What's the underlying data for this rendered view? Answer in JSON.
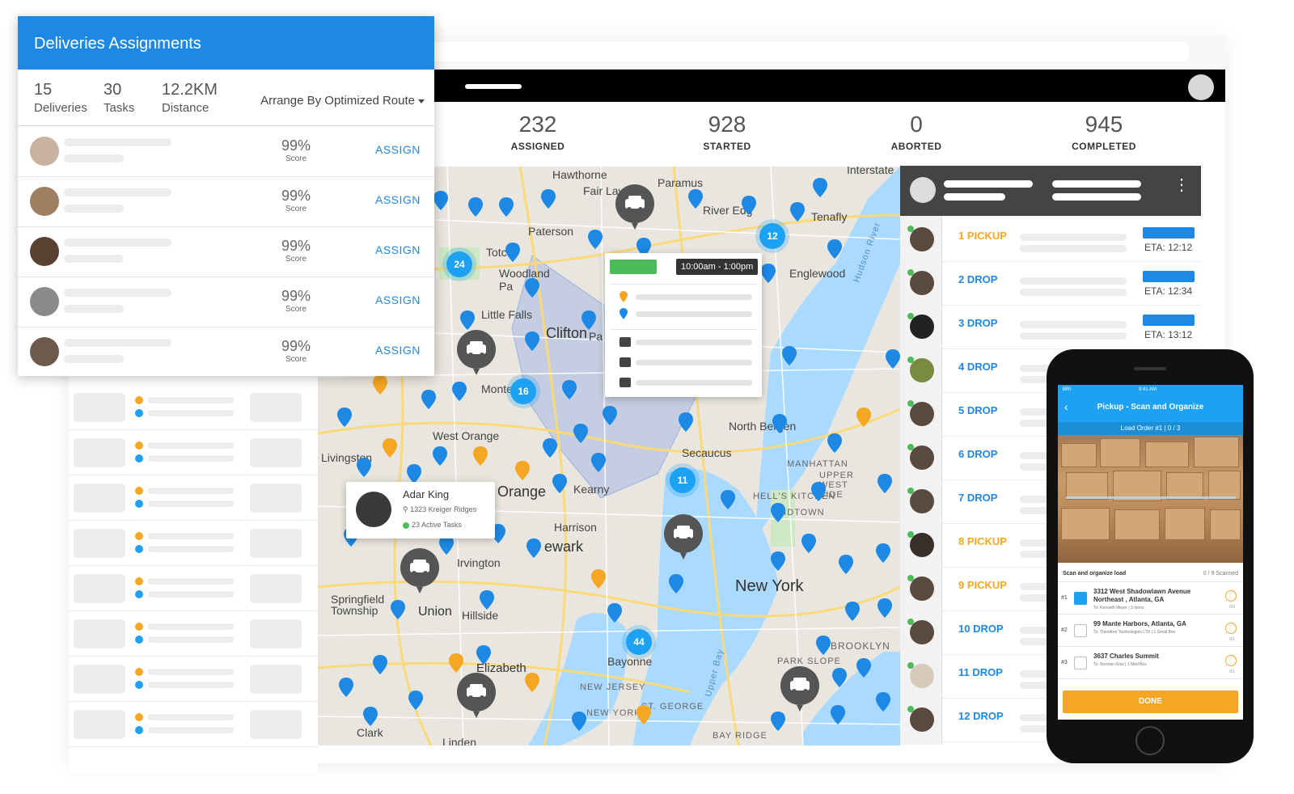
{
  "assignments": {
    "title": "Deliveries Assignments",
    "summary": [
      {
        "value": "15",
        "label": "Deliveries"
      },
      {
        "value": "30",
        "label": "Tasks"
      },
      {
        "value": "12.2KM",
        "label": "Distance"
      }
    ],
    "arrange_label": "Arrange By Optimized Route",
    "rows": [
      {
        "score": "99%",
        "score_label": "Score",
        "action": "ASSIGN"
      },
      {
        "score": "99%",
        "score_label": "Score",
        "action": "ASSIGN"
      },
      {
        "score": "99%",
        "score_label": "Score",
        "action": "ASSIGN"
      },
      {
        "score": "99%",
        "score_label": "Score",
        "action": "ASSIGN"
      },
      {
        "score": "99%",
        "score_label": "Score",
        "action": "ASSIGN"
      }
    ]
  },
  "stats": [
    {
      "value": "232",
      "label": "ASSIGNED"
    },
    {
      "value": "928",
      "label": "STARTED"
    },
    {
      "value": "0",
      "label": "ABORTED"
    },
    {
      "value": "945",
      "label": "COMPLETED"
    }
  ],
  "map": {
    "places": [
      "Hawthorne",
      "Paramus",
      "Fair Law",
      "River Edg",
      "Interstate",
      "Paterson",
      "Tenafly",
      "Totc",
      "Woodland Pa",
      "Englewood",
      "Little Falls",
      "Clifton",
      "Pa",
      "Monte",
      "North Bergen",
      "West Orange",
      "Secaucus",
      "Livingston",
      "t Orange",
      "Kearny",
      "MANHATTAN",
      "UPPER WEST SIDE",
      "HELL'S KITCHEN",
      "MIDTOWN",
      "Harrison",
      "ewark",
      "Irvington",
      "New York",
      "Springfield Township",
      "Union",
      "Hillside",
      "BROOKLYN",
      "Elizabeth",
      "Bayonne",
      "PARK SLOPE",
      "NEW JERSEY",
      "NEW YORK",
      "ST. GEORGE",
      "BAY RIDGE",
      "Clark",
      "Linden",
      "Hudson River",
      "Upper Bay"
    ],
    "clusters": [
      "12",
      "24",
      "16",
      "11",
      "44"
    ],
    "popup_time": "10:00am - 1:00pm",
    "driver": {
      "name": "Adar King",
      "address": "1323 Kreiger Ridges",
      "tasks": "23 Active Tasks"
    }
  },
  "route": {
    "stops": [
      {
        "label": "1 PICKUP",
        "type": "pickup",
        "eta": "ETA: 12:12"
      },
      {
        "label": "2 DROP",
        "type": "drop",
        "eta": "ETA: 12:34"
      },
      {
        "label": "3 DROP",
        "type": "drop",
        "eta": "ETA: 13:12"
      },
      {
        "label": "4 DROP",
        "type": "drop",
        "eta": ""
      },
      {
        "label": "5 DROP",
        "type": "drop",
        "eta": ""
      },
      {
        "label": "6 DROP",
        "type": "drop",
        "eta": ""
      },
      {
        "label": "7 DROP",
        "type": "drop",
        "eta": ""
      },
      {
        "label": "8 PICKUP",
        "type": "pickup",
        "eta": ""
      },
      {
        "label": "9 PICKUP",
        "type": "pickup",
        "eta": ""
      },
      {
        "label": "10 DROP",
        "type": "drop",
        "eta": ""
      },
      {
        "label": "11 DROP",
        "type": "drop",
        "eta": ""
      },
      {
        "label": "12 DROP",
        "type": "drop",
        "eta": ""
      }
    ],
    "pickup_color": "#f5a623",
    "drop_color": "#1e88e5"
  },
  "phone": {
    "carrier": "BRI",
    "time": "9:41 AM",
    "title": "Pickup - Scan and Organize",
    "load_order": "Load Order #1 | 0 / 3",
    "task_label": "Scan and organize load",
    "scanned": "0 / 9 Scanned",
    "items": [
      {
        "num": "#1",
        "address": "3312 West Shadowlawn Avenue Northeast , Atlanta, GA",
        "sub": "To: Kenneth Meyer | 3 Items",
        "count": "0/3"
      },
      {
        "num": "#2",
        "address": "99 Mante Harbors, Atlanta, GA",
        "sub": "To: Theodore Technologies LTD | 1 Small Box",
        "count": "0/1"
      },
      {
        "num": "#3",
        "address": "3637 Charles Summit",
        "sub": "To: Norman Flow | 1 Med Box",
        "count": "0/1"
      }
    ],
    "done": "DONE"
  },
  "colors": {
    "accent": "#1e88e5",
    "cluster": "#1da1f2",
    "pickup": "#f5a623",
    "active": "#4cbb5a"
  }
}
